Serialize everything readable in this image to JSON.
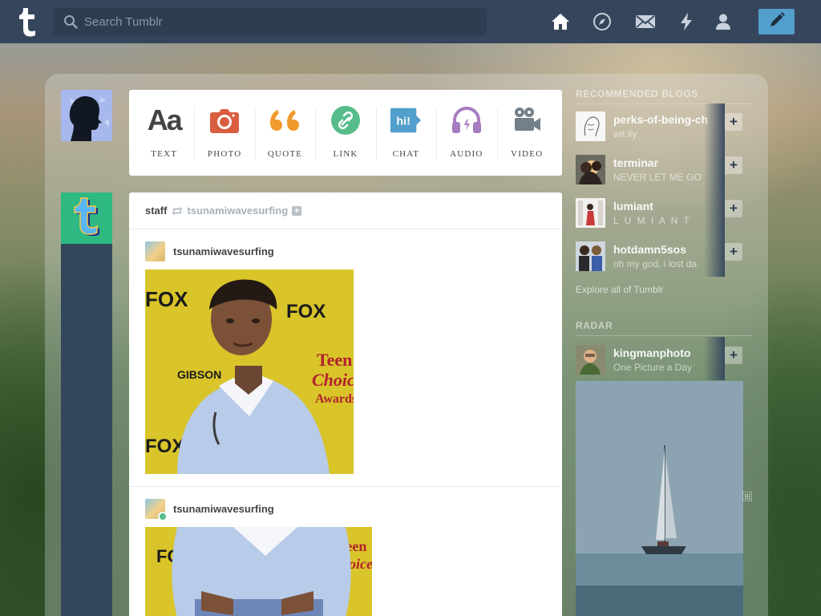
{
  "topbar": {
    "search_placeholder": "Search Tumblr",
    "nav": [
      "home-icon",
      "explore-icon",
      "inbox-icon",
      "activity-icon",
      "account-icon"
    ],
    "compose_icon": "pencil-icon",
    "bar_color": "#35465c",
    "compose_color": "#529ecc"
  },
  "post_types": [
    {
      "label": "TEXT",
      "icon": "text-icon",
      "color": "#444444"
    },
    {
      "label": "PHOTO",
      "icon": "camera-icon",
      "color": "#d95e40"
    },
    {
      "label": "QUOTE",
      "icon": "quote-icon",
      "color": "#f2992e"
    },
    {
      "label": "LINK",
      "icon": "link-icon",
      "color": "#56bc8a"
    },
    {
      "label": "CHAT",
      "icon": "chat-icon",
      "color": "#529ecc"
    },
    {
      "label": "AUDIO",
      "icon": "headphones-icon",
      "color": "#a77dc2"
    },
    {
      "label": "VIDEO",
      "icon": "video-icon",
      "color": "#748089"
    }
  ],
  "post": {
    "author": "staff",
    "source": "tsunamiwavesurfing",
    "trail": [
      {
        "user": "tsunamiwavesurfing"
      },
      {
        "user": "tsunamiwavesurfing"
      }
    ],
    "photo_caption_words": [
      "FOX",
      "FOX",
      "Teen",
      "Choice",
      "Awards",
      "GIBSON",
      "FOX"
    ]
  },
  "sidebar": {
    "recommended_title": "RECOMMENDED BLOGS",
    "blogs": [
      {
        "name": "perks-of-being-ch",
        "sub": "wit lly"
      },
      {
        "name": "terminar",
        "sub": "NEVER LET ME GO"
      },
      {
        "name": "lumiant",
        "sub": "L U M I A N T"
      },
      {
        "name": "hotdamn5sos",
        "sub": "oh my god, i lost da"
      }
    ],
    "explore_link": "Explore all of Tumblr",
    "radar_title": "RADAR",
    "radar": {
      "name": "kingmanphoto",
      "sub": "One Picture a Day"
    },
    "follow_label": "+"
  }
}
